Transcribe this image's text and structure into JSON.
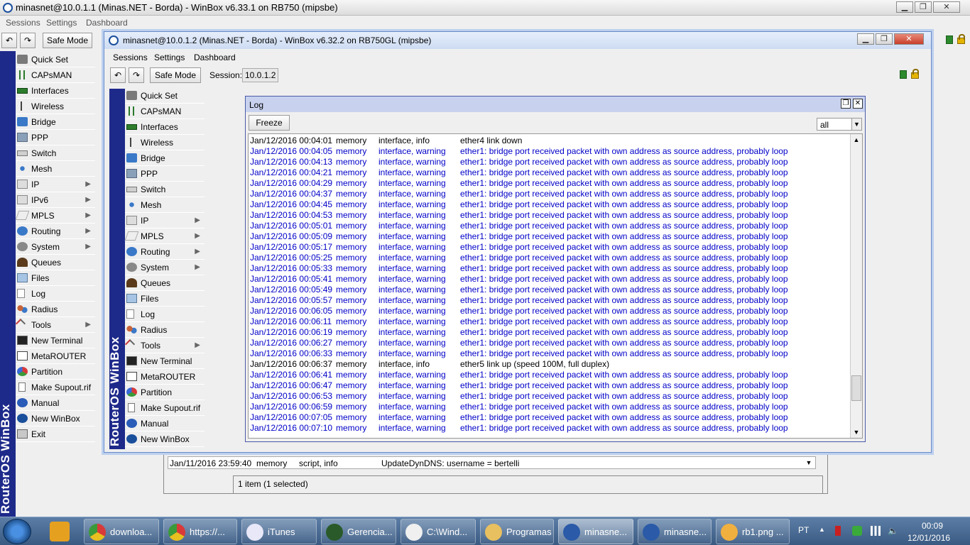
{
  "outer": {
    "title": "minasnet@10.0.1.1 (Minas.NET - Borda) - WinBox v6.33.1 on RB750 (mipsbe)",
    "menu": [
      "Sessions",
      "Settings",
      "Dashboard"
    ],
    "safe_mode": "Safe Mode",
    "brand_vertical": "RouterOS WinBox",
    "sidebar": [
      {
        "label": "Quick Set",
        "icon": "quickset",
        "arrow": false
      },
      {
        "label": "CAPsMAN",
        "icon": "caps",
        "arrow": false
      },
      {
        "label": "Interfaces",
        "icon": "iface",
        "arrow": false
      },
      {
        "label": "Wireless",
        "icon": "wireless",
        "arrow": false
      },
      {
        "label": "Bridge",
        "icon": "bridge",
        "arrow": false
      },
      {
        "label": "PPP",
        "icon": "ppp",
        "arrow": false
      },
      {
        "label": "Switch",
        "icon": "switch",
        "arrow": false
      },
      {
        "label": "Mesh",
        "icon": "mesh",
        "arrow": false
      },
      {
        "label": "IP",
        "icon": "ip",
        "arrow": true
      },
      {
        "label": "IPv6",
        "icon": "ipv6",
        "arrow": true
      },
      {
        "label": "MPLS",
        "icon": "mpls",
        "arrow": true
      },
      {
        "label": "Routing",
        "icon": "routing",
        "arrow": true
      },
      {
        "label": "System",
        "icon": "system",
        "arrow": true
      },
      {
        "label": "Queues",
        "icon": "queues",
        "arrow": false
      },
      {
        "label": "Files",
        "icon": "files",
        "arrow": false
      },
      {
        "label": "Log",
        "icon": "log",
        "arrow": false
      },
      {
        "label": "Radius",
        "icon": "radius",
        "arrow": false
      },
      {
        "label": "Tools",
        "icon": "tools",
        "arrow": true
      },
      {
        "label": "New Terminal",
        "icon": "terminal",
        "arrow": false
      },
      {
        "label": "MetaROUTER",
        "icon": "metarouter",
        "arrow": false
      },
      {
        "label": "Partition",
        "icon": "partition",
        "arrow": false
      },
      {
        "label": "Make Supout.rif",
        "icon": "supout",
        "arrow": false
      },
      {
        "label": "Manual",
        "icon": "manual",
        "arrow": false
      },
      {
        "label": "New WinBox",
        "icon": "newwinbox",
        "arrow": false
      },
      {
        "label": "Exit",
        "icon": "exit",
        "arrow": false
      }
    ],
    "bg_log_row": {
      "time": "Jan/11/2016 23:59:40",
      "buffer": "memory",
      "topics": "script, info",
      "message": "UpdateDynDNS: username = bertelli"
    },
    "bg_log_status": "1 item (1 selected)"
  },
  "inner": {
    "title": "minasnet@10.0.1.2 (Minas.NET - Borda) - WinBox v6.32.2 on RB750GL (mipsbe)",
    "menu": [
      "Sessions",
      "Settings",
      "Dashboard"
    ],
    "safe_mode": "Safe Mode",
    "session_label": "Session:",
    "session_value": "10.0.1.2",
    "brand_vertical": "RouterOS WinBox",
    "sidebar": [
      {
        "label": "Quick Set",
        "icon": "quickset",
        "arrow": false
      },
      {
        "label": "CAPsMAN",
        "icon": "caps",
        "arrow": false
      },
      {
        "label": "Interfaces",
        "icon": "iface",
        "arrow": false
      },
      {
        "label": "Wireless",
        "icon": "wireless",
        "arrow": false
      },
      {
        "label": "Bridge",
        "icon": "bridge",
        "arrow": false
      },
      {
        "label": "PPP",
        "icon": "ppp",
        "arrow": false
      },
      {
        "label": "Switch",
        "icon": "switch",
        "arrow": false
      },
      {
        "label": "Mesh",
        "icon": "mesh",
        "arrow": false
      },
      {
        "label": "IP",
        "icon": "ip",
        "arrow": true
      },
      {
        "label": "MPLS",
        "icon": "mpls",
        "arrow": true
      },
      {
        "label": "Routing",
        "icon": "routing",
        "arrow": true
      },
      {
        "label": "System",
        "icon": "system",
        "arrow": true
      },
      {
        "label": "Queues",
        "icon": "queues",
        "arrow": false
      },
      {
        "label": "Files",
        "icon": "files",
        "arrow": false
      },
      {
        "label": "Log",
        "icon": "log",
        "arrow": false
      },
      {
        "label": "Radius",
        "icon": "radius",
        "arrow": false
      },
      {
        "label": "Tools",
        "icon": "tools",
        "arrow": true
      },
      {
        "label": "New Terminal",
        "icon": "terminal",
        "arrow": false
      },
      {
        "label": "MetaROUTER",
        "icon": "metarouter",
        "arrow": false
      },
      {
        "label": "Partition",
        "icon": "partition",
        "arrow": false
      },
      {
        "label": "Make Supout.rif",
        "icon": "supout",
        "arrow": false
      },
      {
        "label": "Manual",
        "icon": "manual",
        "arrow": false
      },
      {
        "label": "New WinBox",
        "icon": "newwinbox",
        "arrow": false
      }
    ]
  },
  "log_window": {
    "title": "Log",
    "freeze_label": "Freeze",
    "filter_value": "all",
    "colors": {
      "info": "#000000",
      "warning": "#0000c8"
    },
    "rows": [
      {
        "time": "Jan/12/2016 00:04:01",
        "buffer": "memory",
        "topics": "interface, info",
        "message": "ether4 link down",
        "level": "info"
      },
      {
        "time": "Jan/12/2016 00:04:05",
        "buffer": "memory",
        "topics": "interface, warning",
        "message": "ether1: bridge port received packet with own address as source address, probably loop",
        "level": "warning"
      },
      {
        "time": "Jan/12/2016 00:04:13",
        "buffer": "memory",
        "topics": "interface, warning",
        "message": "ether1: bridge port received packet with own address as source address, probably loop",
        "level": "warning"
      },
      {
        "time": "Jan/12/2016 00:04:21",
        "buffer": "memory",
        "topics": "interface, warning",
        "message": "ether1: bridge port received packet with own address as source address, probably loop",
        "level": "warning"
      },
      {
        "time": "Jan/12/2016 00:04:29",
        "buffer": "memory",
        "topics": "interface, warning",
        "message": "ether1: bridge port received packet with own address as source address, probably loop",
        "level": "warning"
      },
      {
        "time": "Jan/12/2016 00:04:37",
        "buffer": "memory",
        "topics": "interface, warning",
        "message": "ether1: bridge port received packet with own address as source address, probably loop",
        "level": "warning"
      },
      {
        "time": "Jan/12/2016 00:04:45",
        "buffer": "memory",
        "topics": "interface, warning",
        "message": "ether1: bridge port received packet with own address as source address, probably loop",
        "level": "warning"
      },
      {
        "time": "Jan/12/2016 00:04:53",
        "buffer": "memory",
        "topics": "interface, warning",
        "message": "ether1: bridge port received packet with own address as source address, probably loop",
        "level": "warning"
      },
      {
        "time": "Jan/12/2016 00:05:01",
        "buffer": "memory",
        "topics": "interface, warning",
        "message": "ether1: bridge port received packet with own address as source address, probably loop",
        "level": "warning"
      },
      {
        "time": "Jan/12/2016 00:05:09",
        "buffer": "memory",
        "topics": "interface, warning",
        "message": "ether1: bridge port received packet with own address as source address, probably loop",
        "level": "warning"
      },
      {
        "time": "Jan/12/2016 00:05:17",
        "buffer": "memory",
        "topics": "interface, warning",
        "message": "ether1: bridge port received packet with own address as source address, probably loop",
        "level": "warning"
      },
      {
        "time": "Jan/12/2016 00:05:25",
        "buffer": "memory",
        "topics": "interface, warning",
        "message": "ether1: bridge port received packet with own address as source address, probably loop",
        "level": "warning"
      },
      {
        "time": "Jan/12/2016 00:05:33",
        "buffer": "memory",
        "topics": "interface, warning",
        "message": "ether1: bridge port received packet with own address as source address, probably loop",
        "level": "warning"
      },
      {
        "time": "Jan/12/2016 00:05:41",
        "buffer": "memory",
        "topics": "interface, warning",
        "message": "ether1: bridge port received packet with own address as source address, probably loop",
        "level": "warning"
      },
      {
        "time": "Jan/12/2016 00:05:49",
        "buffer": "memory",
        "topics": "interface, warning",
        "message": "ether1: bridge port received packet with own address as source address, probably loop",
        "level": "warning"
      },
      {
        "time": "Jan/12/2016 00:05:57",
        "buffer": "memory",
        "topics": "interface, warning",
        "message": "ether1: bridge port received packet with own address as source address, probably loop",
        "level": "warning"
      },
      {
        "time": "Jan/12/2016 00:06:05",
        "buffer": "memory",
        "topics": "interface, warning",
        "message": "ether1: bridge port received packet with own address as source address, probably loop",
        "level": "warning"
      },
      {
        "time": "Jan/12/2016 00:06:11",
        "buffer": "memory",
        "topics": "interface, warning",
        "message": "ether1: bridge port received packet with own address as source address, probably loop",
        "level": "warning"
      },
      {
        "time": "Jan/12/2016 00:06:19",
        "buffer": "memory",
        "topics": "interface, warning",
        "message": "ether1: bridge port received packet with own address as source address, probably loop",
        "level": "warning"
      },
      {
        "time": "Jan/12/2016 00:06:27",
        "buffer": "memory",
        "topics": "interface, warning",
        "message": "ether1: bridge port received packet with own address as source address, probably loop",
        "level": "warning"
      },
      {
        "time": "Jan/12/2016 00:06:33",
        "buffer": "memory",
        "topics": "interface, warning",
        "message": "ether1: bridge port received packet with own address as source address, probably loop",
        "level": "warning"
      },
      {
        "time": "Jan/12/2016 00:06:37",
        "buffer": "memory",
        "topics": "interface, info",
        "message": "ether5 link up (speed 100M, full duplex)",
        "level": "info"
      },
      {
        "time": "Jan/12/2016 00:06:41",
        "buffer": "memory",
        "topics": "interface, warning",
        "message": "ether1: bridge port received packet with own address as source address, probably loop",
        "level": "warning"
      },
      {
        "time": "Jan/12/2016 00:06:47",
        "buffer": "memory",
        "topics": "interface, warning",
        "message": "ether1: bridge port received packet with own address as source address, probably loop",
        "level": "warning"
      },
      {
        "time": "Jan/12/2016 00:06:53",
        "buffer": "memory",
        "topics": "interface, warning",
        "message": "ether1: bridge port received packet with own address as source address, probably loop",
        "level": "warning"
      },
      {
        "time": "Jan/12/2016 00:06:59",
        "buffer": "memory",
        "topics": "interface, warning",
        "message": "ether1: bridge port received packet with own address as source address, probably loop",
        "level": "warning"
      },
      {
        "time": "Jan/12/2016 00:07:05",
        "buffer": "memory",
        "topics": "interface, warning",
        "message": "ether1: bridge port received packet with own address as source address, probably loop",
        "level": "warning"
      },
      {
        "time": "Jan/12/2016 00:07:10",
        "buffer": "memory",
        "topics": "interface, warning",
        "message": "ether1: bridge port received packet with own address as source address, probably loop",
        "level": "warning"
      }
    ]
  },
  "taskbar": {
    "items": [
      {
        "label": "downloa...",
        "icon": "chrome-icon"
      },
      {
        "label": "https://...",
        "icon": "chrome-icon"
      },
      {
        "label": "iTunes",
        "icon": "itunes-icon"
      },
      {
        "label": "Gerencia...",
        "icon": "monitor-icon"
      },
      {
        "label": "C:\\Wind...",
        "icon": "cmd-icon"
      },
      {
        "label": "Programas",
        "icon": "folder-icon"
      },
      {
        "label": "minasne...",
        "icon": "winbox-icon"
      },
      {
        "label": "minasne...",
        "icon": "winbox-icon"
      },
      {
        "label": "rb1.png ...",
        "icon": "paint-icon"
      }
    ],
    "language": "PT",
    "time": "00:09",
    "date": "12/01/2016"
  }
}
